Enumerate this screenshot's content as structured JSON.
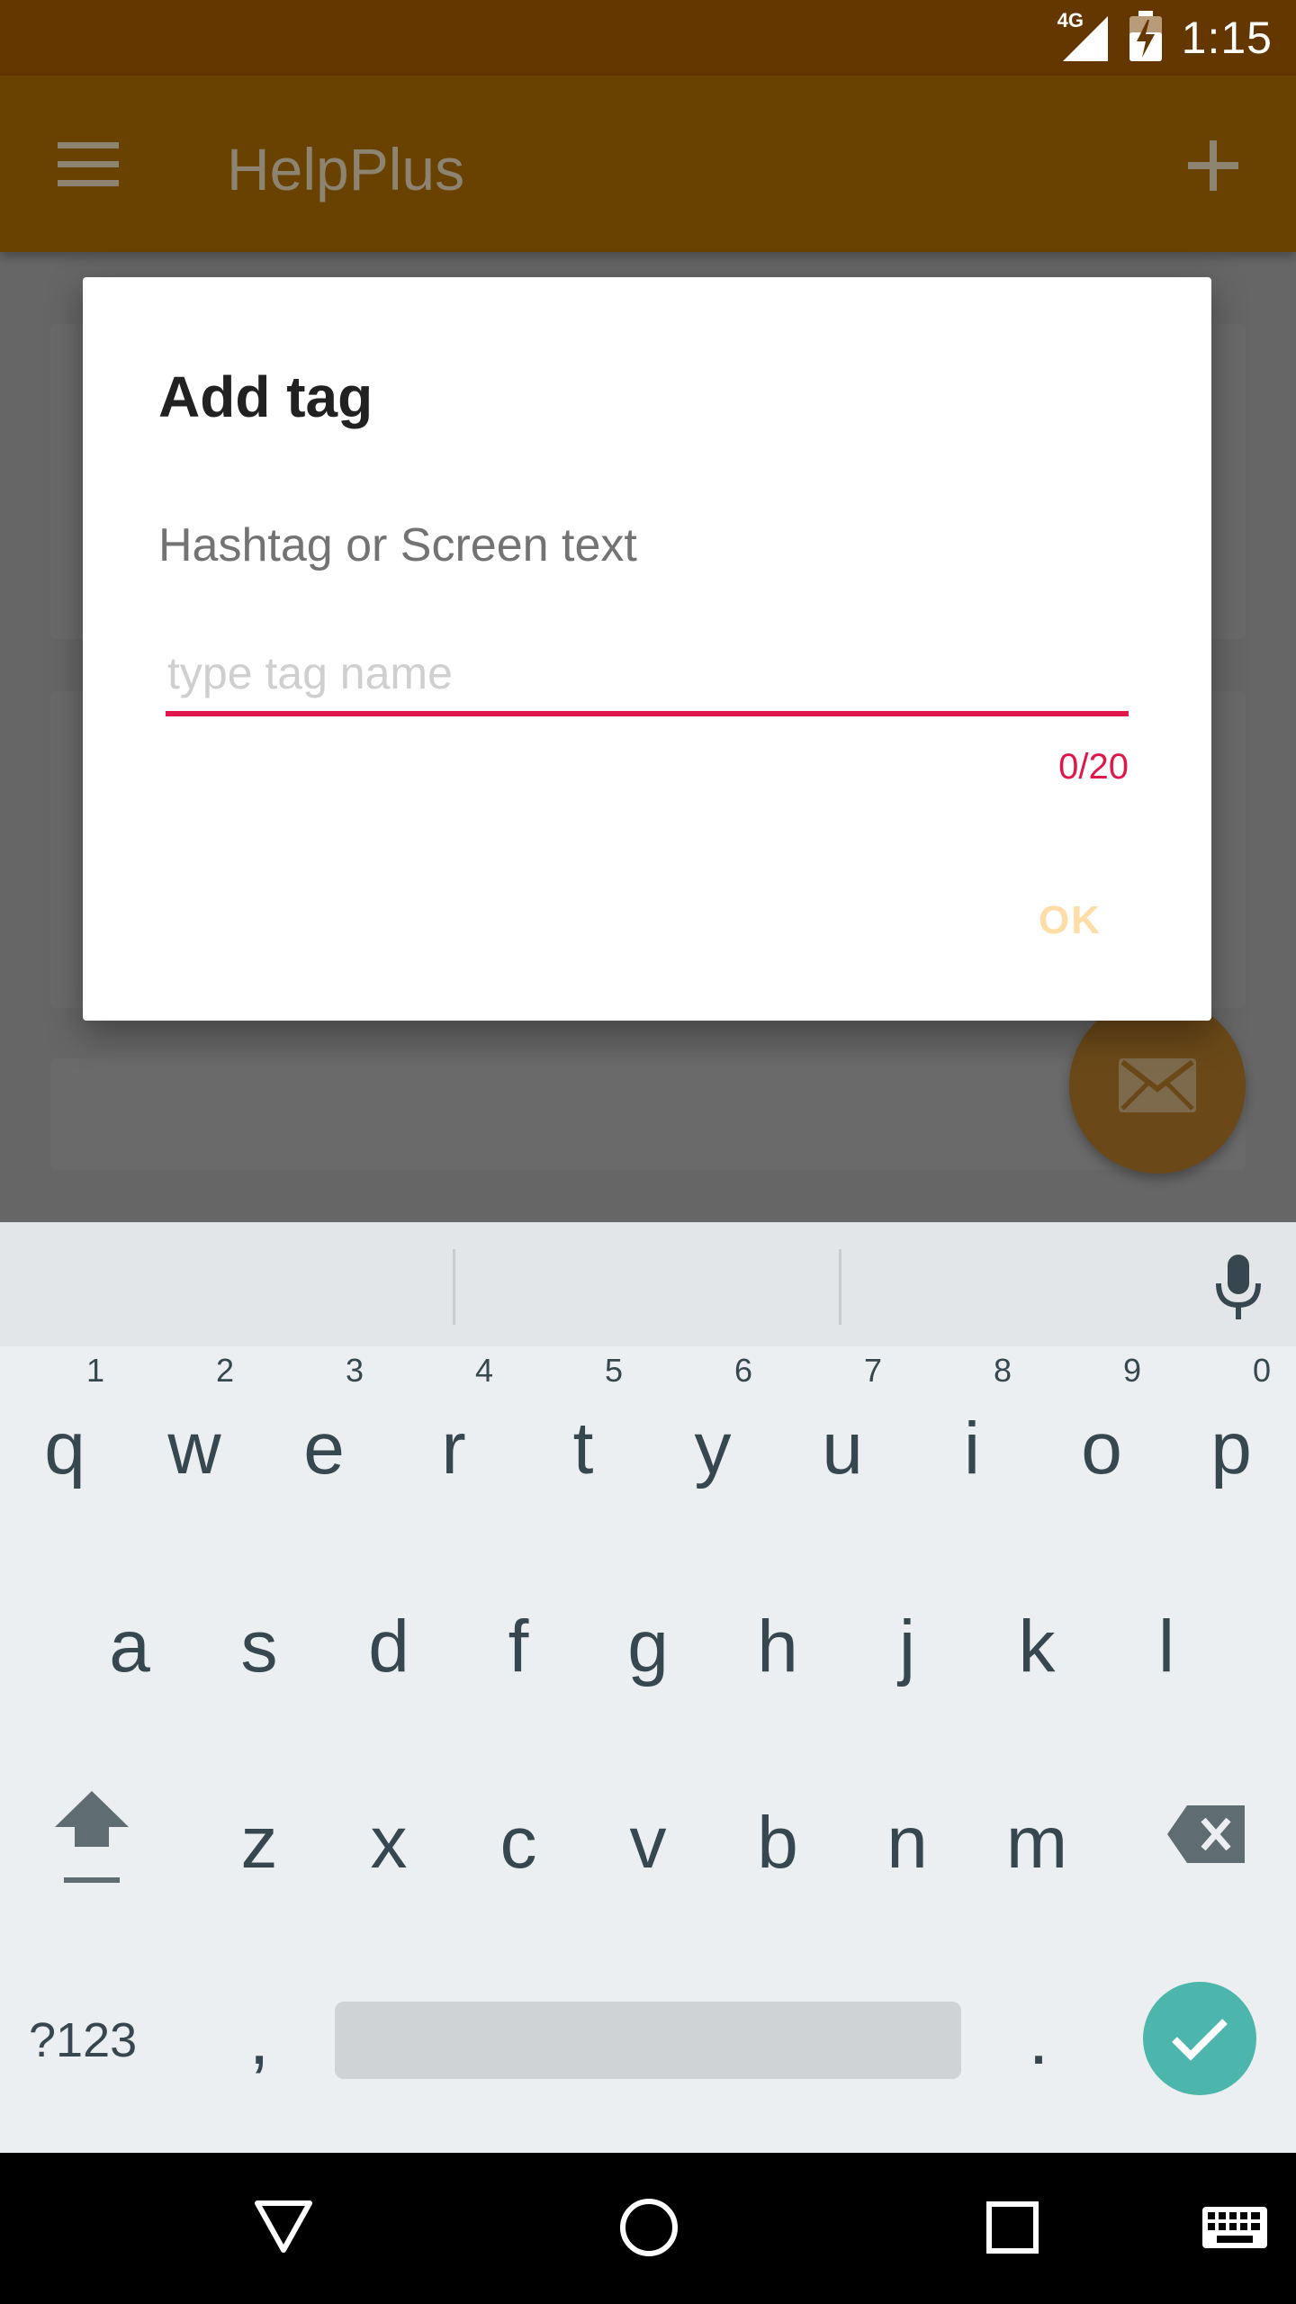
{
  "status_bar": {
    "time": "1:15",
    "network": "4G",
    "icons": [
      "signal-icon",
      "battery-charging-icon"
    ]
  },
  "app_bar": {
    "title": "HelpPlus",
    "icons": [
      "menu-icon",
      "add-icon"
    ]
  },
  "dialog": {
    "title": "Add tag",
    "label": "Hashtag or Screen text",
    "input": {
      "value": "",
      "placeholder": "type tag name"
    },
    "counter": "0/20",
    "ok_label": "OK"
  },
  "fab": {
    "icon": "mail-icon"
  },
  "keyboard": {
    "row1": [
      {
        "key": "q",
        "hint": "1"
      },
      {
        "key": "w",
        "hint": "2"
      },
      {
        "key": "e",
        "hint": "3"
      },
      {
        "key": "r",
        "hint": "4"
      },
      {
        "key": "t",
        "hint": "5"
      },
      {
        "key": "y",
        "hint": "6"
      },
      {
        "key": "u",
        "hint": "7"
      },
      {
        "key": "i",
        "hint": "8"
      },
      {
        "key": "o",
        "hint": "9"
      },
      {
        "key": "p",
        "hint": "0"
      }
    ],
    "row2": [
      "a",
      "s",
      "d",
      "f",
      "g",
      "h",
      "j",
      "k",
      "l"
    ],
    "row3": [
      "z",
      "x",
      "c",
      "v",
      "b",
      "n",
      "m"
    ],
    "symbols_label": "?123",
    "comma": ",",
    "period": ".",
    "icons": [
      "mic-icon",
      "shift-icon",
      "backspace-icon",
      "check-icon"
    ]
  },
  "nav_bar": {
    "icons": [
      "back-icon",
      "home-icon",
      "recents-icon",
      "keyboard-switch-icon"
    ]
  },
  "colors": {
    "status_bar": "#643700",
    "app_bar": "#694100",
    "scrim": "#666666",
    "accent": "#e0174b",
    "ok_text": "#ffdda6",
    "keyboard_bg": "#eceff1",
    "key_text": "#37474f",
    "enter_key": "#4db6ac"
  }
}
